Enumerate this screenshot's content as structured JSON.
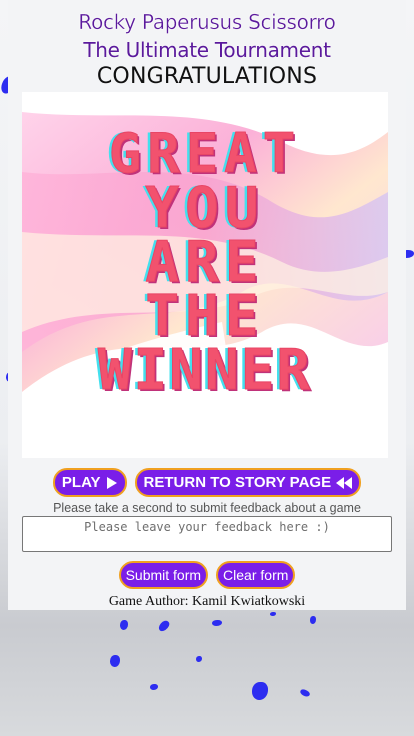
{
  "header": {
    "game_title": "Rocky Paperusus Scissorro",
    "subtitle": "The Ultimate Tournament",
    "status": "CONGRATULATIONS"
  },
  "banner": {
    "lines": [
      "GREAT",
      "YOU",
      "ARE",
      "THE",
      "WINNER"
    ]
  },
  "actions": {
    "play_label": "PLAY",
    "play_icon": "play-triangle-icon",
    "story_label": "RETURN TO STORY PAGE",
    "story_icon": "rewind-icon"
  },
  "feedback": {
    "hint": "Please take a second to submit feedback about a game",
    "placeholder": "Please leave your feedback here :)",
    "submit_label": "Submit form",
    "clear_label": "Clear form"
  },
  "footer": {
    "author": "Game Author: Kamil Kwiatkowski"
  },
  "colors": {
    "button_bg": "#7a1ee8",
    "button_border": "#f0a020",
    "title": "#5b1a9c",
    "winner_text": "#f2526e",
    "confetti": "#2d2df0"
  }
}
